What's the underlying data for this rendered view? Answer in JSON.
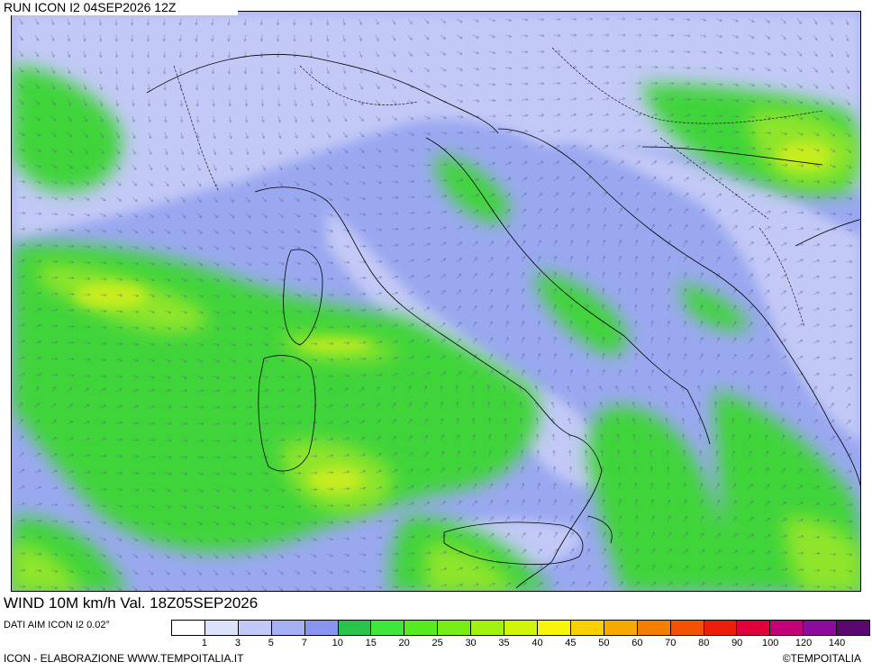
{
  "header": {
    "run_label": "RUN ICON I2 04SEP2026 12Z"
  },
  "title": "WIND 10M km/h Val. 18Z05SEP2026",
  "source": "DATI AIM ICON I2 0.02°",
  "footer": {
    "left": "ICON - ELABORAZIONE WWW.TEMPOITALIA.IT",
    "right": "©TEMPOITALIA"
  },
  "legend": {
    "tick_labels": [
      "1",
      "3",
      "5",
      "7",
      "10",
      "15",
      "20",
      "25",
      "30",
      "35",
      "40",
      "45",
      "50",
      "60",
      "70",
      "80",
      "90",
      "100",
      "120",
      "140"
    ],
    "colors": [
      "#ffffff",
      "#dde2fb",
      "#c2c9f6",
      "#a4b0f3",
      "#8894ef",
      "#27c34a",
      "#3ee83b",
      "#56ec1f",
      "#76ee13",
      "#a1f30e",
      "#d0f50a",
      "#f7f50a",
      "#f8d005",
      "#f7a900",
      "#f57d00",
      "#f55100",
      "#ee1c0a",
      "#e0003b",
      "#c40078",
      "#8c0a9c",
      "#5a0870"
    ]
  },
  "map": {
    "field": "wind speed 10 m",
    "colors": {
      "sea_calm": "#9aa8f0",
      "land_calm": "#bcc4f5",
      "wind_green": "#3fd43a",
      "wind_lime": "#8fe52a",
      "wind_yellow": "#d4ef1a",
      "arrows": "#5a5a8a",
      "borders": "#000000"
    }
  }
}
